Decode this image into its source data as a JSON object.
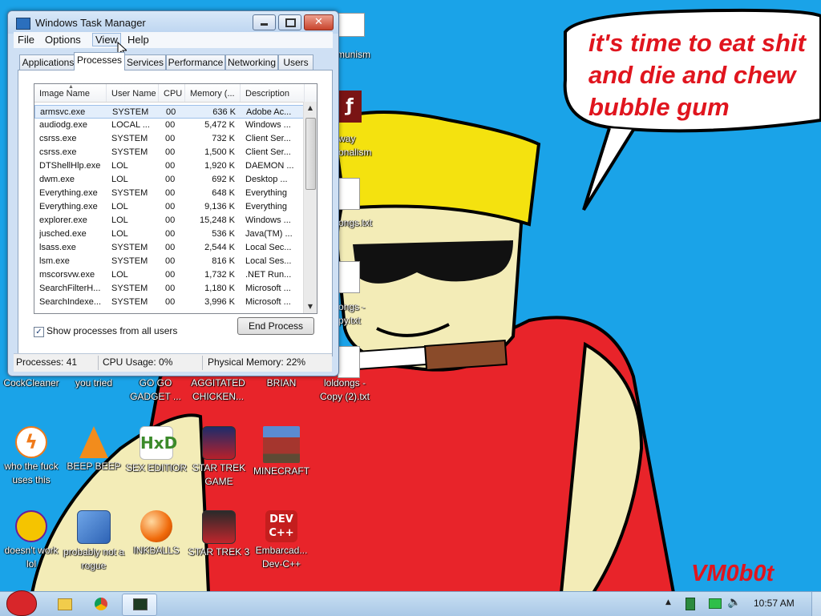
{
  "wallpaper": {
    "speech_bubble_text": "it's time to eat shit and die and chew bubble gum",
    "signature": "VM0b0t",
    "colors": {
      "sky": "#1aa3e8",
      "accent_red": "#e0151e",
      "hair": "#f4e20f",
      "skin": "#f3ecb7"
    }
  },
  "desktop": {
    "partial_labels": [
      "munism",
      "way",
      "onalism",
      "ongs.txt",
      "ongs -",
      "py.txt"
    ],
    "icons": [
      {
        "label": "CockCleaner",
        "icon": "app-icon"
      },
      {
        "label": "you tried",
        "icon": "app-icon"
      },
      {
        "label": "GO GO GADGET ...",
        "icon": "app-icon"
      },
      {
        "label": "AGGITATED CHICKEN...",
        "icon": "app-icon"
      },
      {
        "label": "BRIAN",
        "icon": "app-icon"
      },
      {
        "label": "loldongs - Copy (2).txt",
        "icon": "text-file-icon"
      },
      {
        "label": "who the fuck uses this",
        "icon": "avast-icon"
      },
      {
        "label": "BEEP BEEP",
        "icon": "vlc-cone-icon"
      },
      {
        "label": "SEX EDITIOR",
        "icon": "hxd-icon"
      },
      {
        "label": "STAR TREK GAME",
        "icon": "star-wars-game-icon"
      },
      {
        "label": "MINECRAFT",
        "icon": "minecraft-icon"
      },
      {
        "label": "doesn't work lol",
        "icon": "yahoo-icon"
      },
      {
        "label": "probably not a rogue",
        "icon": "gears-icon"
      },
      {
        "label": "INKBALLS",
        "icon": "inkball-icon"
      },
      {
        "label": "STAR TREK 3",
        "icon": "star-wars-game-icon"
      },
      {
        "label": "Embarcad... Dev-C++",
        "icon": "devcpp-icon"
      }
    ]
  },
  "taskmanager": {
    "title": "Windows Task Manager",
    "menu": [
      "File",
      "Options",
      "View",
      "Help"
    ],
    "tabs": [
      "Applications",
      "Processes",
      "Services",
      "Performance",
      "Networking",
      "Users"
    ],
    "active_tab": "Processes",
    "columns": [
      "Image Name",
      "User Name",
      "CPU",
      "Memory (...",
      "Description"
    ],
    "rows": [
      {
        "name": "armsvc.exe",
        "user": "SYSTEM",
        "cpu": "00",
        "mem": "636 K",
        "desc": "Adobe Ac..."
      },
      {
        "name": "audiodg.exe",
        "user": "LOCAL ...",
        "cpu": "00",
        "mem": "5,472 K",
        "desc": "Windows ..."
      },
      {
        "name": "csrss.exe",
        "user": "SYSTEM",
        "cpu": "00",
        "mem": "732 K",
        "desc": "Client Ser..."
      },
      {
        "name": "csrss.exe",
        "user": "SYSTEM",
        "cpu": "00",
        "mem": "1,500 K",
        "desc": "Client Ser..."
      },
      {
        "name": "DTShellHlp.exe",
        "user": "LOL",
        "cpu": "00",
        "mem": "1,920 K",
        "desc": "DAEMON ..."
      },
      {
        "name": "dwm.exe",
        "user": "LOL",
        "cpu": "00",
        "mem": "692 K",
        "desc": "Desktop ..."
      },
      {
        "name": "Everything.exe",
        "user": "SYSTEM",
        "cpu": "00",
        "mem": "648 K",
        "desc": "Everything"
      },
      {
        "name": "Everything.exe",
        "user": "LOL",
        "cpu": "00",
        "mem": "9,136 K",
        "desc": "Everything"
      },
      {
        "name": "explorer.exe",
        "user": "LOL",
        "cpu": "00",
        "mem": "15,248 K",
        "desc": "Windows ..."
      },
      {
        "name": "jusched.exe",
        "user": "LOL",
        "cpu": "00",
        "mem": "536 K",
        "desc": "Java(TM) ..."
      },
      {
        "name": "lsass.exe",
        "user": "SYSTEM",
        "cpu": "00",
        "mem": "2,544 K",
        "desc": "Local Sec..."
      },
      {
        "name": "lsm.exe",
        "user": "SYSTEM",
        "cpu": "00",
        "mem": "816 K",
        "desc": "Local Ses..."
      },
      {
        "name": "mscorsvw.exe",
        "user": "LOL",
        "cpu": "00",
        "mem": "1,732 K",
        "desc": ".NET Run..."
      },
      {
        "name": "SearchFilterH...",
        "user": "SYSTEM",
        "cpu": "00",
        "mem": "1,180 K",
        "desc": "Microsoft ..."
      },
      {
        "name": "SearchIndexe...",
        "user": "SYSTEM",
        "cpu": "00",
        "mem": "3,996 K",
        "desc": "Microsoft ..."
      }
    ],
    "show_all_label": "Show processes from all users",
    "show_all_checked": true,
    "end_process_label": "End Process",
    "status": {
      "processes": "Processes: 41",
      "cpu": "CPU Usage: 0%",
      "memory": "Physical Memory: 22%"
    }
  },
  "taskbar": {
    "clock": "10:57 AM",
    "pinned": [
      "angry-birds-start-icon",
      "explorer-folder-icon",
      "chrome-icon",
      "task-manager-icon"
    ]
  }
}
